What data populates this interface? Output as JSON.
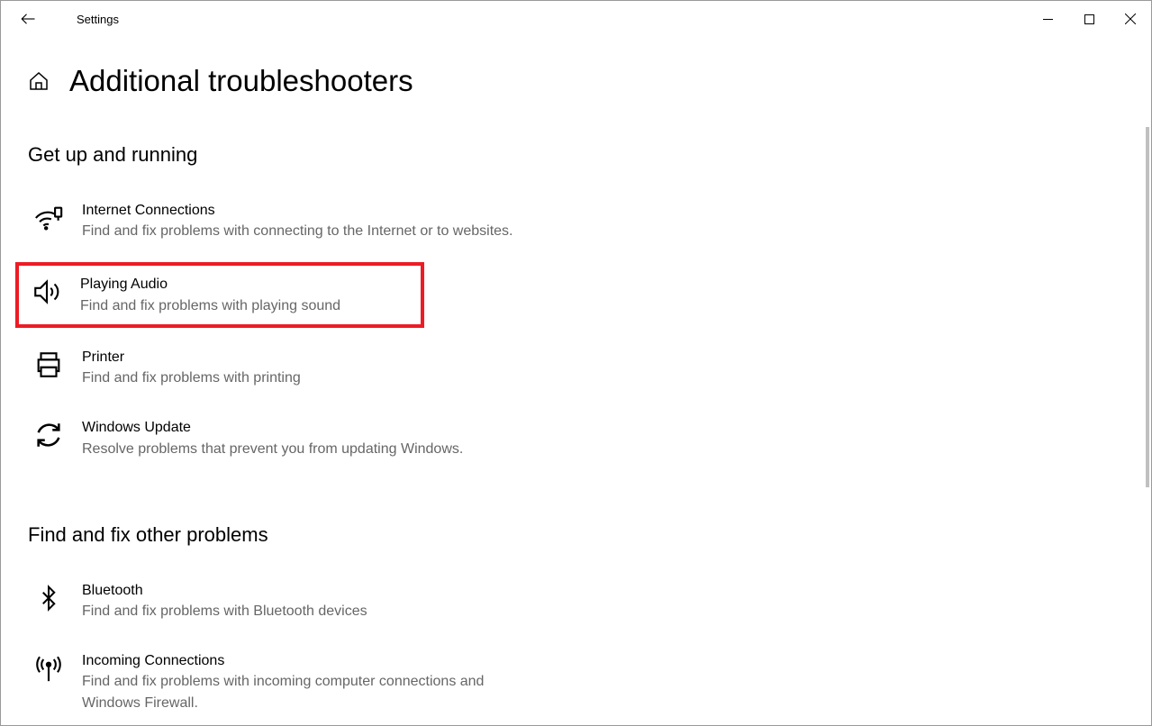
{
  "window": {
    "title": "Settings"
  },
  "page": {
    "title": "Additional troubleshooters"
  },
  "sections": [
    {
      "heading": "Get up and running",
      "items": [
        {
          "icon": "wifi-icon",
          "title": "Internet Connections",
          "description": "Find and fix problems with connecting to the Internet or to websites.",
          "highlighted": false
        },
        {
          "icon": "speaker-icon",
          "title": "Playing Audio",
          "description": "Find and fix problems with playing sound",
          "highlighted": true
        },
        {
          "icon": "printer-icon",
          "title": "Printer",
          "description": "Find and fix problems with printing",
          "highlighted": false
        },
        {
          "icon": "update-icon",
          "title": "Windows Update",
          "description": "Resolve problems that prevent you from updating Windows.",
          "highlighted": false
        }
      ]
    },
    {
      "heading": "Find and fix other problems",
      "items": [
        {
          "icon": "bluetooth-icon",
          "title": "Bluetooth",
          "description": "Find and fix problems with Bluetooth devices",
          "highlighted": false
        },
        {
          "icon": "antenna-icon",
          "title": "Incoming Connections",
          "description": "Find and fix problems with incoming computer connections and Windows Firewall.",
          "highlighted": false
        }
      ]
    }
  ]
}
